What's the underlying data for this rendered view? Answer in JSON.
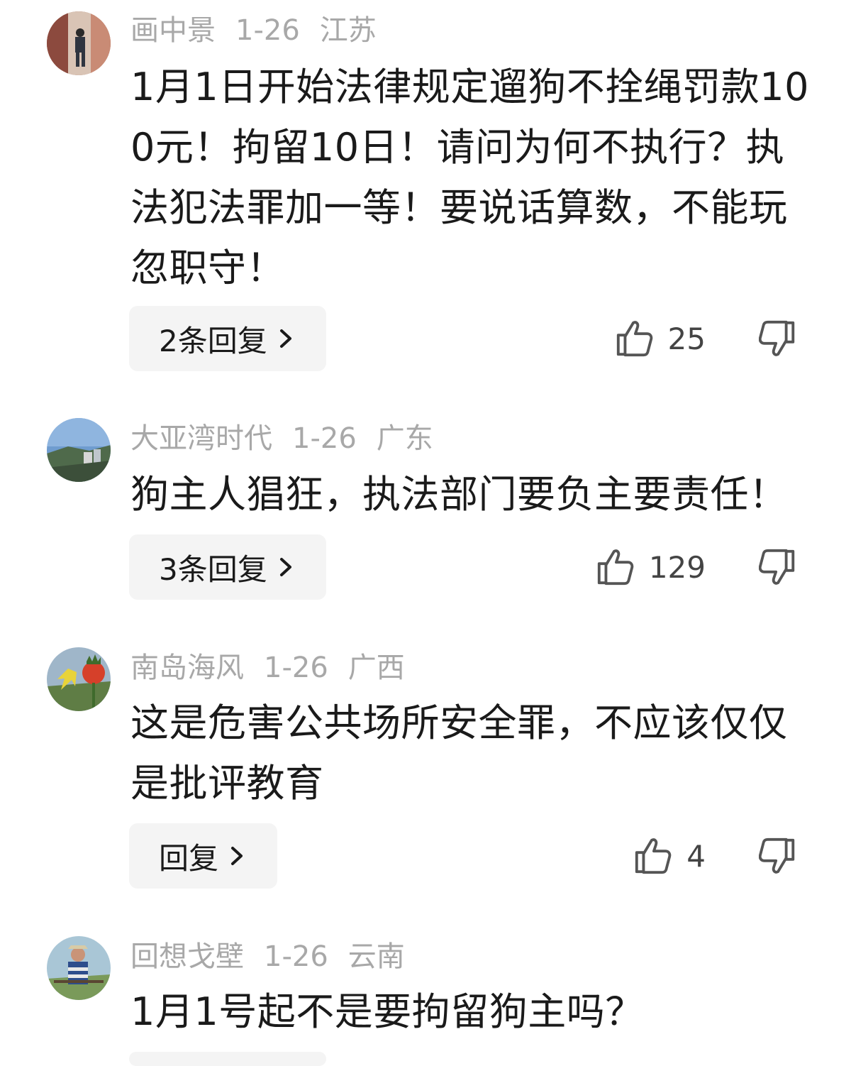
{
  "comments": [
    {
      "username": "画中景",
      "date": "1-26",
      "location": "江苏",
      "text": "1月1日开始法律规定遛狗不拴绳罚款100元！拘留10日！请问为何不执行？执法犯法罪加一等！要说话算数，不能玩忽职守！",
      "reply_label": "2条回复",
      "likes": "25"
    },
    {
      "username": "大亚湾时代",
      "date": "1-26",
      "location": "广东",
      "text": "狗主人猖狂，执法部门要负主要责任！",
      "reply_label": "3条回复",
      "likes": "129"
    },
    {
      "username": "南岛海风",
      "date": "1-26",
      "location": "广西",
      "text": "这是危害公共场所安全罪，不应该仅仅是批评教育",
      "reply_label": "回复",
      "likes": "4"
    },
    {
      "username": "回想戈壁",
      "date": "1-26",
      "location": "云南",
      "text": "1月1号起不是要拘留狗主吗？"
    }
  ],
  "icons": {
    "like": "thumbs-up-icon",
    "dislike": "thumbs-down-icon",
    "reply_arrow": "chevron-right-icon"
  },
  "colors": {
    "meta_text": "#a8a8a8",
    "body_text": "#1a1a1a",
    "reply_bg": "#f4f4f4",
    "icon": "#555555"
  }
}
